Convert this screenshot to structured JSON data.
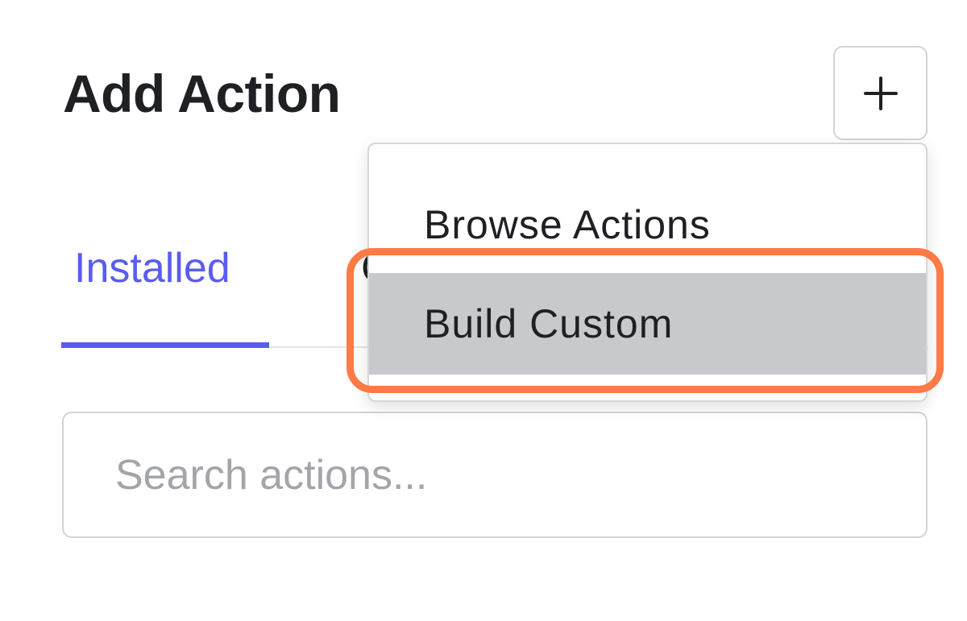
{
  "panel": {
    "title": "Add Action"
  },
  "add_button": {
    "icon": "plus-icon"
  },
  "tabs": [
    {
      "label": "Installed",
      "active": true
    },
    {
      "label": "C",
      "active": false
    }
  ],
  "search": {
    "placeholder": "Search actions...",
    "value": ""
  },
  "dropdown": {
    "items": [
      {
        "label": "Browse Actions",
        "highlighted": false
      },
      {
        "label": "Build Custom",
        "highlighted": true
      }
    ]
  },
  "colors": {
    "accent": "#5a5cf0",
    "highlight_ring": "#ff7a45",
    "hover_bg": "#c8c9cc",
    "text": "#1f2023",
    "placeholder": "#a3a5aa"
  }
}
